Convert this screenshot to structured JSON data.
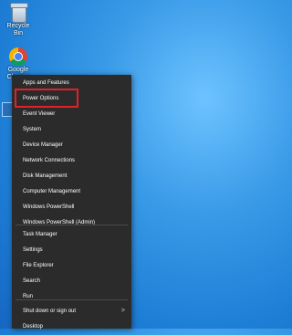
{
  "desktop": {
    "recycle_bin_label": "Recycle Bin",
    "chrome_label": "Google Chrome"
  },
  "menu": {
    "group1": [
      {
        "label": "Apps and Features"
      },
      {
        "label": "Power Options"
      },
      {
        "label": "Event Viewer"
      },
      {
        "label": "System"
      },
      {
        "label": "Device Manager"
      },
      {
        "label": "Network Connections"
      },
      {
        "label": "Disk Management"
      },
      {
        "label": "Computer Management"
      },
      {
        "label": "Windows PowerShell"
      },
      {
        "label": "Windows PowerShell (Admin)"
      }
    ],
    "group2": [
      {
        "label": "Task Manager"
      },
      {
        "label": "Settings"
      },
      {
        "label": "File Explorer"
      },
      {
        "label": "Search"
      },
      {
        "label": "Run"
      }
    ],
    "group3": [
      {
        "label": "Shut down or sign out",
        "has_submenu": true,
        "arrow": ">"
      },
      {
        "label": "Desktop"
      }
    ]
  },
  "highlight": {
    "target": "Power Options",
    "color": "#e0202a"
  }
}
